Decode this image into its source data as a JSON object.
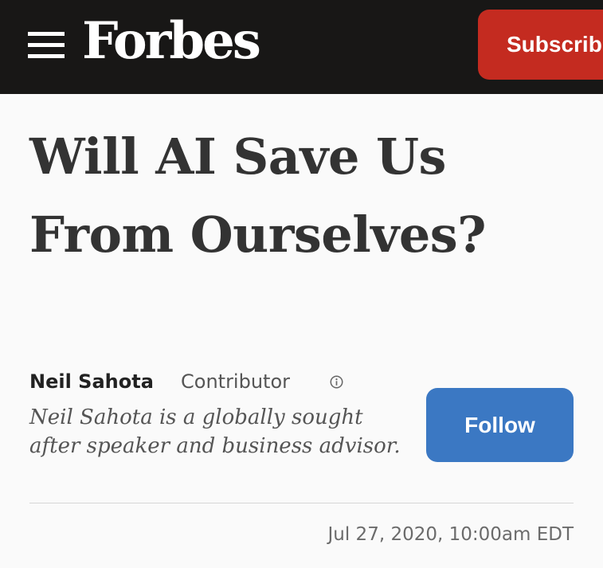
{
  "header": {
    "logo_text": "Forbes",
    "subscribe_label": "Subscrib",
    "menu_icon": "hamburger-menu-icon",
    "background_color": "#181716",
    "subscribe_color": "#c42b20"
  },
  "article": {
    "headline_line1": "Will AI Save Us",
    "headline_line2": "From Ourselves?",
    "author": {
      "name": "Neil Sahota",
      "role": "Contributor",
      "info_icon": "info-circle-icon",
      "bio": "Neil Sahota is a globally sought after speaker and business advisor."
    },
    "follow_label": "Follow",
    "follow_color": "#3b78c3",
    "date": "Jul 27, 2020, 10:00am EDT"
  }
}
